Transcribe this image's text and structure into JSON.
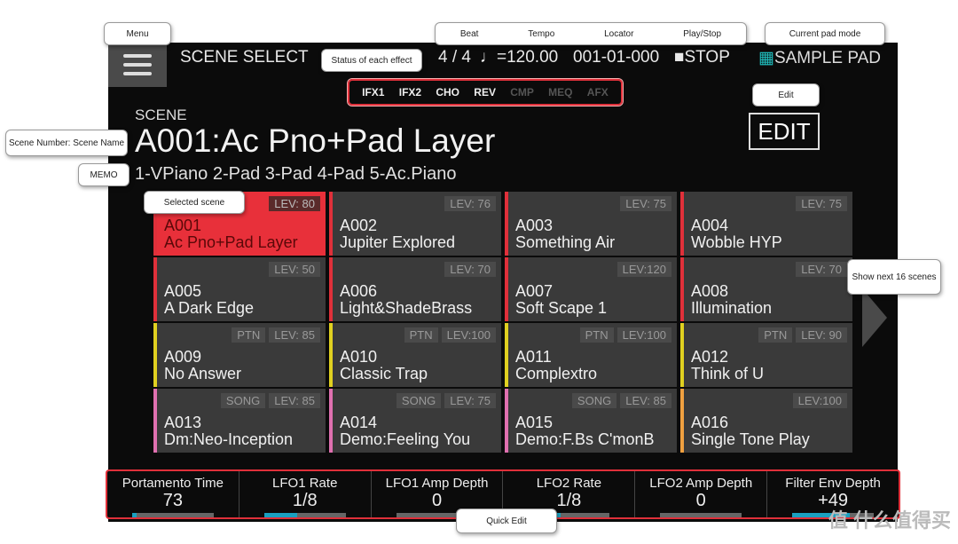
{
  "header": {
    "title": "SCENE SELECT",
    "beat": "4 / 4",
    "tempo": "♩=120.00",
    "locator": "001-01-000",
    "play_stop": "■STOP",
    "pad_mode": "SAMPLE PAD"
  },
  "effects": [
    {
      "label": "IFX1",
      "on": true
    },
    {
      "label": "IFX2",
      "on": true
    },
    {
      "label": "CHO",
      "on": true
    },
    {
      "label": "REV",
      "on": true
    },
    {
      "label": "CMP",
      "on": false
    },
    {
      "label": "MEQ",
      "on": false
    },
    {
      "label": "AFX",
      "on": false
    }
  ],
  "scene": {
    "label": "SCENE",
    "name": "A001:Ac Pno+Pad Layer",
    "memo": "1-VPiano 2-Pad 3-Pad 4-Pad 5-Ac.Piano"
  },
  "edit_label": "EDIT",
  "colors": {
    "accent": "#e8303a",
    "red": "#e0303a",
    "yellow": "#e0d020",
    "pink": "#e070b0",
    "orange": "#f0a040"
  },
  "scenes": [
    {
      "num": "A001",
      "name": "Ac Pno+Pad Layer",
      "lev": "LEV: 80",
      "tag": "",
      "color": "red",
      "selected": true
    },
    {
      "num": "A002",
      "name": "Jupiter Explored",
      "lev": "LEV: 76",
      "tag": "",
      "color": "red"
    },
    {
      "num": "A003",
      "name": "Something Air",
      "lev": "LEV: 75",
      "tag": "",
      "color": "red"
    },
    {
      "num": "A004",
      "name": "Wobble HYP",
      "lev": "LEV: 75",
      "tag": "",
      "color": "red"
    },
    {
      "num": "A005",
      "name": "A Dark Edge",
      "lev": "LEV: 50",
      "tag": "",
      "color": "red"
    },
    {
      "num": "A006",
      "name": "Light&ShadeBrass",
      "lev": "LEV: 70",
      "tag": "",
      "color": "red"
    },
    {
      "num": "A007",
      "name": "Soft Scape 1",
      "lev": "LEV:120",
      "tag": "",
      "color": "red"
    },
    {
      "num": "A008",
      "name": "Illumination",
      "lev": "LEV: 70",
      "tag": "",
      "color": "red"
    },
    {
      "num": "A009",
      "name": "No Answer",
      "lev": "LEV: 85",
      "tag": "PTN",
      "color": "yellow"
    },
    {
      "num": "A010",
      "name": "Classic Trap",
      "lev": "LEV:100",
      "tag": "PTN",
      "color": "yellow"
    },
    {
      "num": "A011",
      "name": "Complextro",
      "lev": "LEV:100",
      "tag": "PTN",
      "color": "yellow"
    },
    {
      "num": "A012",
      "name": "Think of U",
      "lev": "LEV: 90",
      "tag": "PTN",
      "color": "yellow"
    },
    {
      "num": "A013",
      "name": "Dm:Neo-Inception",
      "lev": "LEV: 85",
      "tag": "SONG",
      "color": "pink"
    },
    {
      "num": "A014",
      "name": "Demo:Feeling You",
      "lev": "LEV: 75",
      "tag": "SONG",
      "color": "pink"
    },
    {
      "num": "A015",
      "name": "Demo:F.Bs C'monB",
      "lev": "LEV: 85",
      "tag": "SONG",
      "color": "pink"
    },
    {
      "num": "A016",
      "name": "Single Tone Play",
      "lev": "LEV:100",
      "tag": "",
      "color": "orange"
    }
  ],
  "quick_edit": [
    {
      "label": "Portamento Time",
      "value": "73",
      "level": 0.05
    },
    {
      "label": "LFO1 Rate",
      "value": "1/8",
      "level": 0.4
    },
    {
      "label": "LFO1 Amp Depth",
      "value": "0",
      "level": 0
    },
    {
      "label": "LFO2 Rate",
      "value": "1/8",
      "level": 0.4
    },
    {
      "label": "LFO2 Amp Depth",
      "value": "0",
      "level": 0
    },
    {
      "label": "Filter Env Depth",
      "value": "+49",
      "level": 0.7
    }
  ],
  "callouts": {
    "menu": "Menu",
    "beat": "Beat",
    "tempo": "Tempo",
    "locator": "Locator",
    "play_stop": "Play/Stop",
    "pad_mode": "Current pad mode",
    "effects": "Status of each effect",
    "edit": "Edit",
    "scene_name": "Scene Number: Scene Name",
    "memo": "MEMO",
    "selected": "Selected scene",
    "next": "Show next 16 scenes",
    "quick_edit": "Quick Edit"
  },
  "watermark": "值 什么值得买"
}
